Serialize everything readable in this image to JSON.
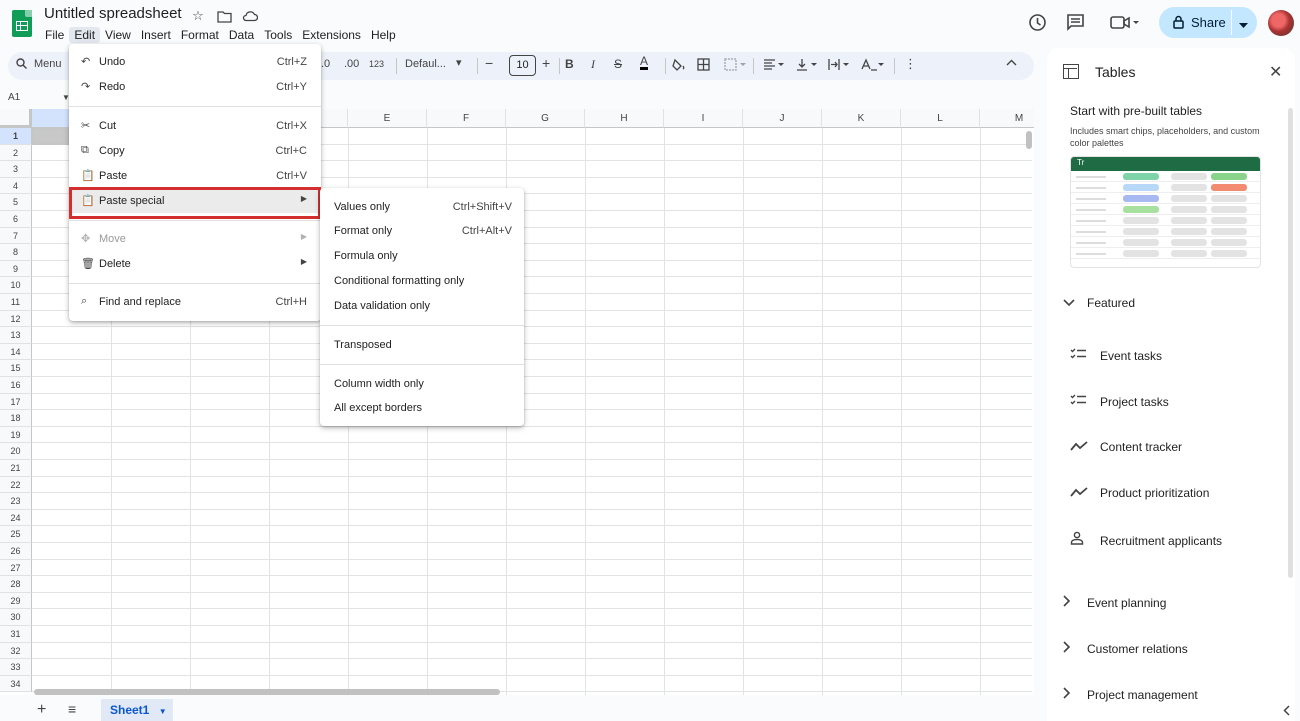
{
  "header": {
    "doc_title": "Untitled spreadsheet",
    "menus": [
      "File",
      "Edit",
      "View",
      "Insert",
      "Format",
      "Data",
      "Tools",
      "Extensions",
      "Help"
    ],
    "active_menu": "Edit",
    "share_label": "Share"
  },
  "toolbar": {
    "search_label": "Menu",
    "decimal_decrease": ".0",
    "decimal_increase": ".00",
    "format_123": "123",
    "font_name": "Defaul...",
    "font_size": "10",
    "bold": "B",
    "italic": "I",
    "text_color": "A"
  },
  "name_box": "A1",
  "columns": [
    "E",
    "F",
    "G",
    "H",
    "I",
    "J",
    "K",
    "L",
    "M"
  ],
  "rows": [
    "1",
    "2",
    "3",
    "4",
    "5",
    "6",
    "7",
    "8",
    "9",
    "10",
    "11",
    "12",
    "13",
    "14",
    "15",
    "16",
    "17",
    "18",
    "19",
    "20",
    "21",
    "22",
    "23",
    "24",
    "25",
    "26",
    "27",
    "28",
    "29",
    "30",
    "31",
    "32",
    "33",
    "34"
  ],
  "sheet_tab": "Sheet1",
  "edit_menu": {
    "items": [
      {
        "icon": "undo-icon",
        "label": "Undo",
        "shortcut": "Ctrl+Z"
      },
      {
        "icon": "redo-icon",
        "label": "Redo",
        "shortcut": "Ctrl+Y"
      },
      {
        "icon": "cut-icon",
        "label": "Cut",
        "shortcut": "Ctrl+X"
      },
      {
        "icon": "copy-icon",
        "label": "Copy",
        "shortcut": "Ctrl+C"
      },
      {
        "icon": "paste-icon",
        "label": "Paste",
        "shortcut": "Ctrl+V"
      },
      {
        "icon": "paste-special-icon",
        "label": "Paste special"
      },
      {
        "icon": "move-icon",
        "label": "Move"
      },
      {
        "icon": "delete-icon",
        "label": "Delete"
      },
      {
        "icon": "find-replace-icon",
        "label": "Find and replace",
        "shortcut": "Ctrl+H"
      }
    ]
  },
  "paste_special_menu": {
    "items": [
      {
        "label": "Values only",
        "shortcut": "Ctrl+Shift+V"
      },
      {
        "label": "Format only",
        "shortcut": "Ctrl+Alt+V"
      },
      {
        "label": "Formula only"
      },
      {
        "label": "Conditional formatting only"
      },
      {
        "label": "Data validation only"
      },
      {
        "label": "Transposed"
      },
      {
        "label": "Column width only"
      },
      {
        "label": "All except borders"
      }
    ]
  },
  "side_panel": {
    "title": "Tables",
    "heading": "Start with pre-built tables",
    "subheading": "Includes smart chips, placeholders, and custom color palettes",
    "preview_header_icon": "Tr",
    "featured_label": "Featured",
    "templates": [
      {
        "icon": "checklist-icon",
        "label": "Event tasks"
      },
      {
        "icon": "checklist-icon",
        "label": "Project tasks"
      },
      {
        "icon": "trend-icon",
        "label": "Content tracker"
      },
      {
        "icon": "trend-icon",
        "label": "Product prioritization"
      },
      {
        "icon": "person-icon",
        "label": "Recruitment applicants"
      }
    ],
    "categories": [
      "Event planning",
      "Customer relations",
      "Project management"
    ]
  },
  "colors": {
    "accent_blue": "#0b57d0",
    "share_bg": "#c2e7ff",
    "highlight_red": "#d32f2f",
    "sheets_green": "#0f9d58"
  }
}
